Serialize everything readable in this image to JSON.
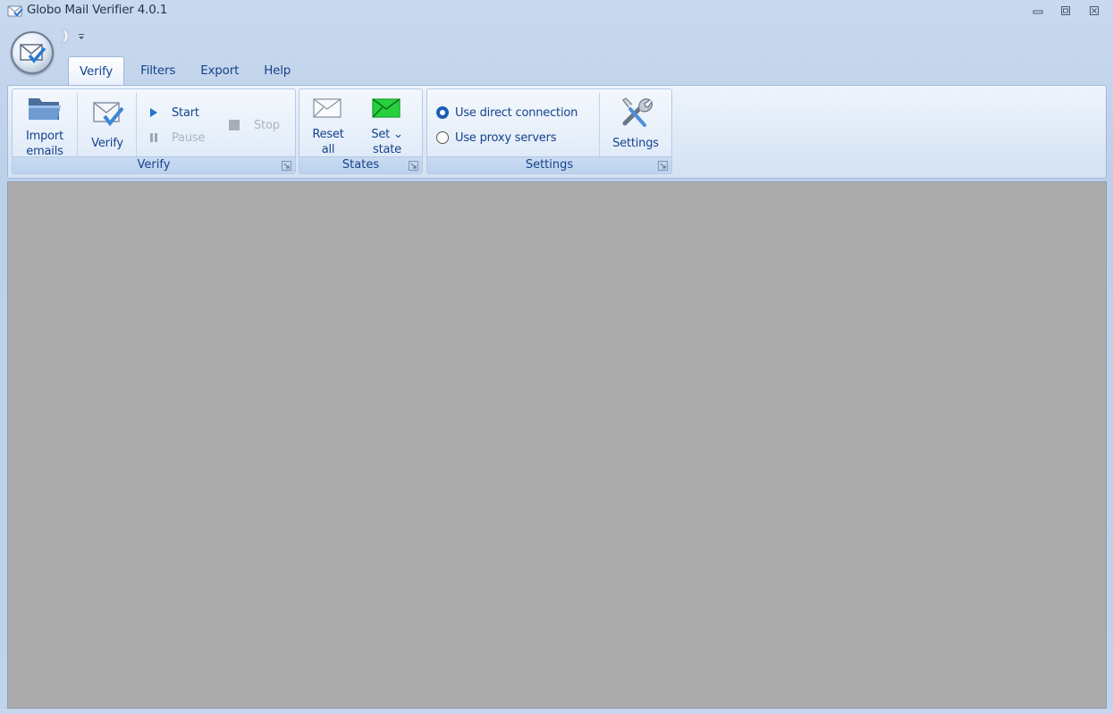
{
  "window": {
    "title": "Globo Mail Verifier 4.0.1",
    "icon": "mail-check-icon",
    "controls": [
      "minimize-icon",
      "restore-icon",
      "close-icon"
    ]
  },
  "tabs": [
    {
      "label": "Verify",
      "active": true
    },
    {
      "label": "Filters",
      "active": false
    },
    {
      "label": "Export",
      "active": false
    },
    {
      "label": "Help",
      "active": false
    }
  ],
  "ribbon": {
    "verify_group": {
      "label": "Verify",
      "import_label": "Import\nemails",
      "verify_label": "Verify",
      "start_label": "Start",
      "pause_label": "Pause",
      "stop_label": "Stop"
    },
    "states_group": {
      "label": "States",
      "reset_label": "Reset\nall",
      "set_state_label": "Set ⌄\nstate"
    },
    "settings_group": {
      "label": "Settings",
      "direct_label": "Use direct connection",
      "proxy_label": "Use proxy servers",
      "selected": "direct",
      "settings_label": "Settings"
    }
  },
  "colors": {
    "accent": "#15428b",
    "workspace": "#ababab",
    "set_state_icon": "#22c93a"
  }
}
